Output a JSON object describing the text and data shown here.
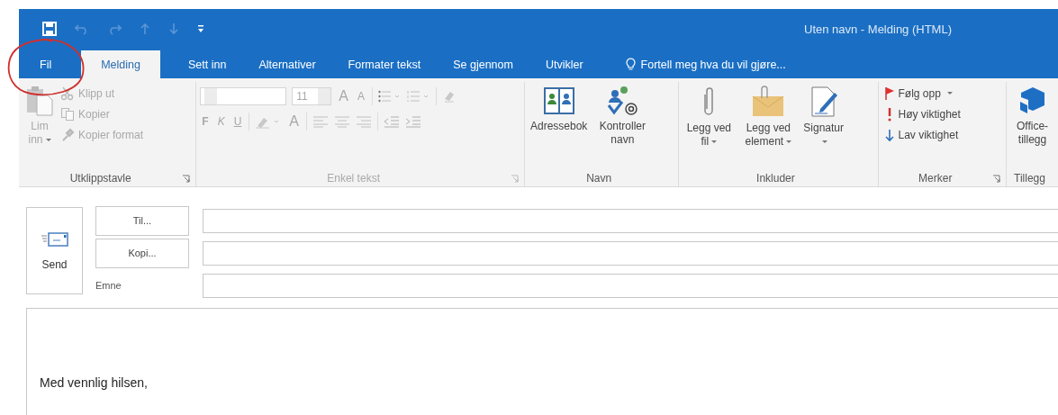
{
  "window": {
    "title": "Uten navn - Melding (HTML)"
  },
  "tabs": [
    {
      "label": "Fil",
      "selected": false
    },
    {
      "label": "Melding",
      "selected": true
    },
    {
      "label": "Sett inn",
      "selected": false
    },
    {
      "label": "Alternativer",
      "selected": false
    },
    {
      "label": "Formater tekst",
      "selected": false
    },
    {
      "label": "Se gjennom",
      "selected": false
    },
    {
      "label": "Utvikler",
      "selected": false
    }
  ],
  "tell_me": {
    "placeholder": "Fortell meg hva du vil gjøre..."
  },
  "ribbon": {
    "clipboard": {
      "label": "Utklippstavle",
      "paste": {
        "label": "Lim inn",
        "disabled": true
      },
      "cut": {
        "label": "Klipp ut",
        "disabled": true
      },
      "copy": {
        "label": "Kopier",
        "disabled": true
      },
      "format_painter": {
        "label": "Kopier format",
        "disabled": true
      }
    },
    "basic_text": {
      "label": "Enkel tekst",
      "disabled": true,
      "font_size": {
        "value": "11"
      },
      "grow": "A",
      "shrink": "A",
      "bold": "F",
      "italic": "K",
      "underline": "U",
      "font_color": "A"
    },
    "names": {
      "label": "Navn",
      "address_book": "Adressebok",
      "check_names": "Kontroller navn"
    },
    "include": {
      "label": "Inkluder",
      "attach_file": "Legg ved fil",
      "attach_item": "Legg ved element",
      "signature": "Signatur"
    },
    "tags": {
      "label": "Merker",
      "follow_up": "Følg opp",
      "high_importance": "Høy viktighet",
      "low_importance": "Lav viktighet"
    },
    "addins": {
      "label": "Tillegg",
      "office_addins": "Office-tillegg"
    }
  },
  "compose": {
    "send": "Send",
    "to_button": "Til...",
    "cc_button": "Kopi...",
    "subject_label": "Emne",
    "body": "Med vennlig hilsen,"
  }
}
